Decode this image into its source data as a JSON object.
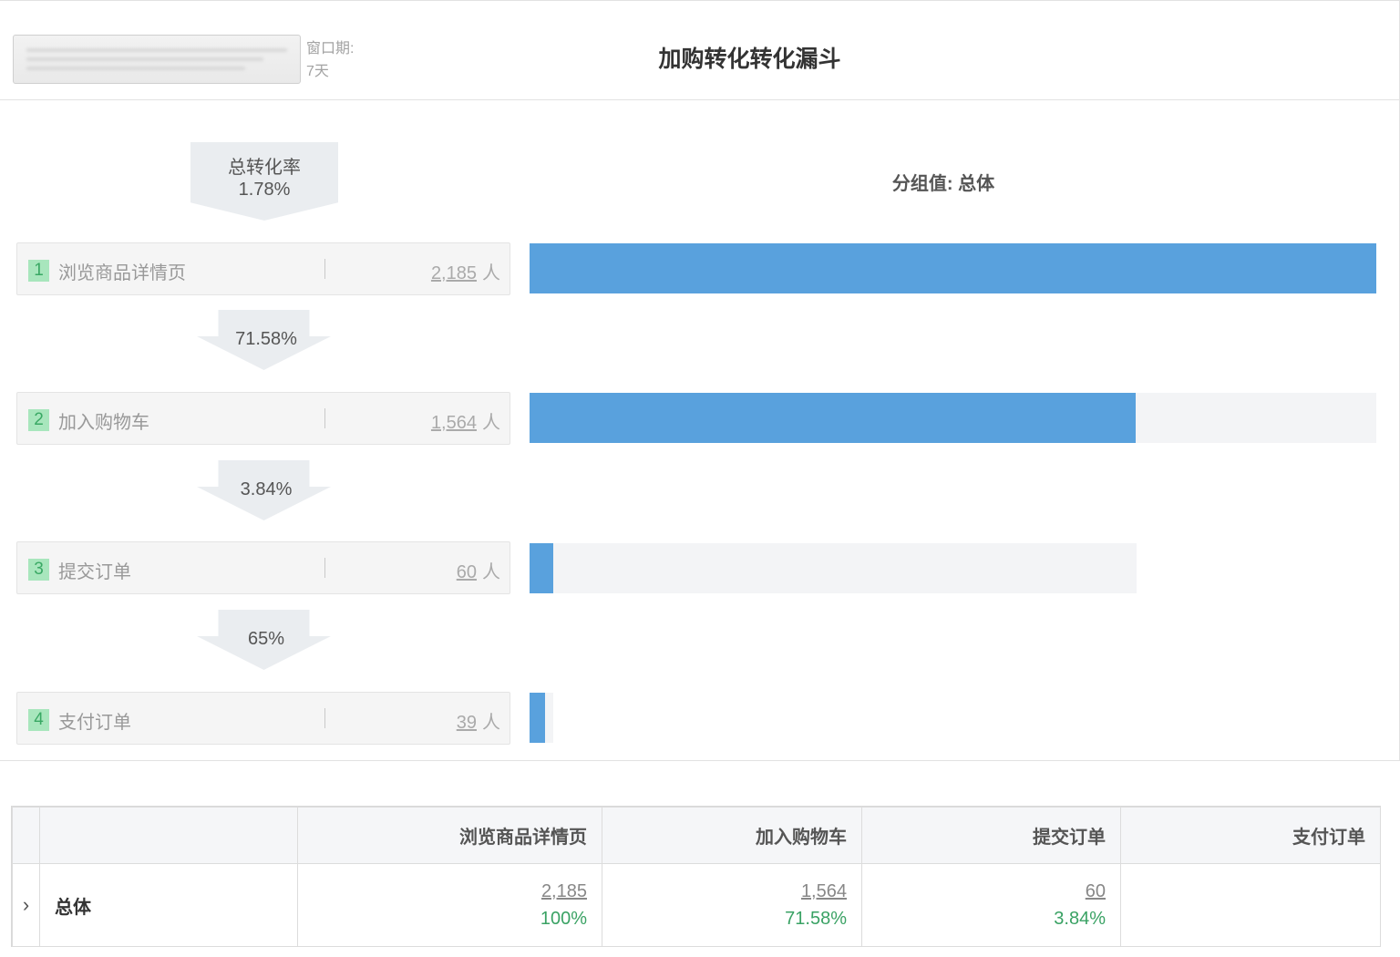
{
  "header": {
    "window_label": "窗口期:",
    "window_value": "7天",
    "title": "加购转化转化漏斗"
  },
  "funnel": {
    "total_label": "总转化率",
    "total_rate": "1.78%",
    "group_label": "分组值: 总体",
    "unit": "人",
    "steps": [
      {
        "index": "1",
        "name": "浏览商品详情页",
        "count": "2,185"
      },
      {
        "index": "2",
        "name": "加入购物车",
        "count": "1,564"
      },
      {
        "index": "3",
        "name": "提交订单",
        "count": "60"
      },
      {
        "index": "4",
        "name": "支付订单",
        "count": "39"
      }
    ],
    "conversions": [
      "71.58%",
      "3.84%",
      "65%"
    ]
  },
  "table": {
    "headers": [
      "",
      "",
      "浏览商品详情页",
      "加入购物车",
      "提交订单",
      "支付订单"
    ],
    "row": {
      "expander": "›",
      "label": "总体",
      "cells": [
        {
          "count": "2,185",
          "pct": "100%"
        },
        {
          "count": "1,564",
          "pct": "71.58%"
        },
        {
          "count": "60",
          "pct": "3.84%"
        },
        {
          "count": "",
          "pct": ""
        }
      ]
    }
  },
  "colors": {
    "bar": "#59a1dd",
    "track": "#f3f4f6",
    "step_badge_bg": "#a8e6bd",
    "step_badge_text": "#39a864",
    "pct_green": "#3aa264"
  },
  "chart_data": {
    "type": "bar",
    "categories": [
      "浏览商品详情页",
      "加入购物车",
      "提交订单",
      "支付订单"
    ],
    "values": [
      2185,
      1564,
      60,
      39
    ],
    "conversion_rates": [
      "71.58%",
      "3.84%",
      "65%"
    ],
    "total_conversion": "1.78%",
    "title": "加购转化转化漏斗",
    "subtitle": "分组值: 总体",
    "orientation": "horizontal",
    "grid": false
  }
}
